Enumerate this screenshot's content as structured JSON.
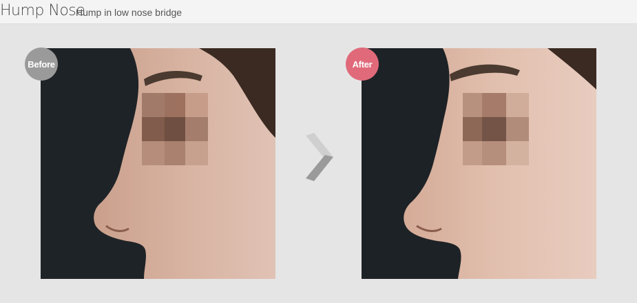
{
  "header": {
    "title": "Hump Nose",
    "subtitle": "Hump in low nose bridge"
  },
  "before": {
    "badge_label": "Before",
    "badge_color": "#9a9a9a"
  },
  "after": {
    "badge_label": "After",
    "badge_color": "#e06a7a"
  },
  "icons": {
    "arrow": "chevron-right-icon"
  }
}
